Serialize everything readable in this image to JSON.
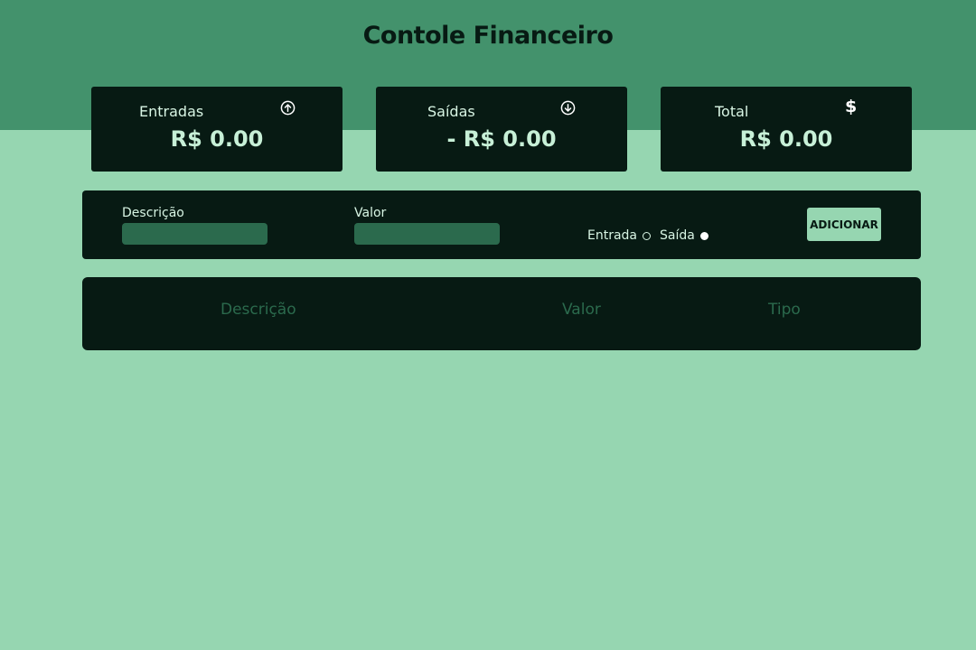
{
  "header": {
    "title": "Contole Financeiro"
  },
  "cards": {
    "entradas": {
      "label": "Entradas",
      "value": "R$ 0.00",
      "icon": "arrow-up-circle-icon"
    },
    "saidas": {
      "label": "Saídas",
      "value": "- R$ 0.00",
      "icon": "arrow-down-circle-icon"
    },
    "total": {
      "label": "Total",
      "value": "R$ 0.00",
      "icon": "dollar-icon",
      "icon_glyph": "$"
    }
  },
  "form": {
    "descricao_label": "Descrição",
    "descricao_value": "",
    "valor_label": "Valor",
    "valor_value": "",
    "radio_entrada_label": "Entrada",
    "radio_saida_label": "Saída",
    "selected_type": "Saída",
    "add_button_label": "ADICIONAR"
  },
  "table": {
    "columns": [
      "Descrição",
      "Valor",
      "Tipo"
    ],
    "rows": []
  },
  "colors": {
    "background": "#96d6b1",
    "header": "#43926c",
    "panel": "#071a13",
    "input": "#2b6a4d",
    "text_light": "#d8f5e4"
  }
}
